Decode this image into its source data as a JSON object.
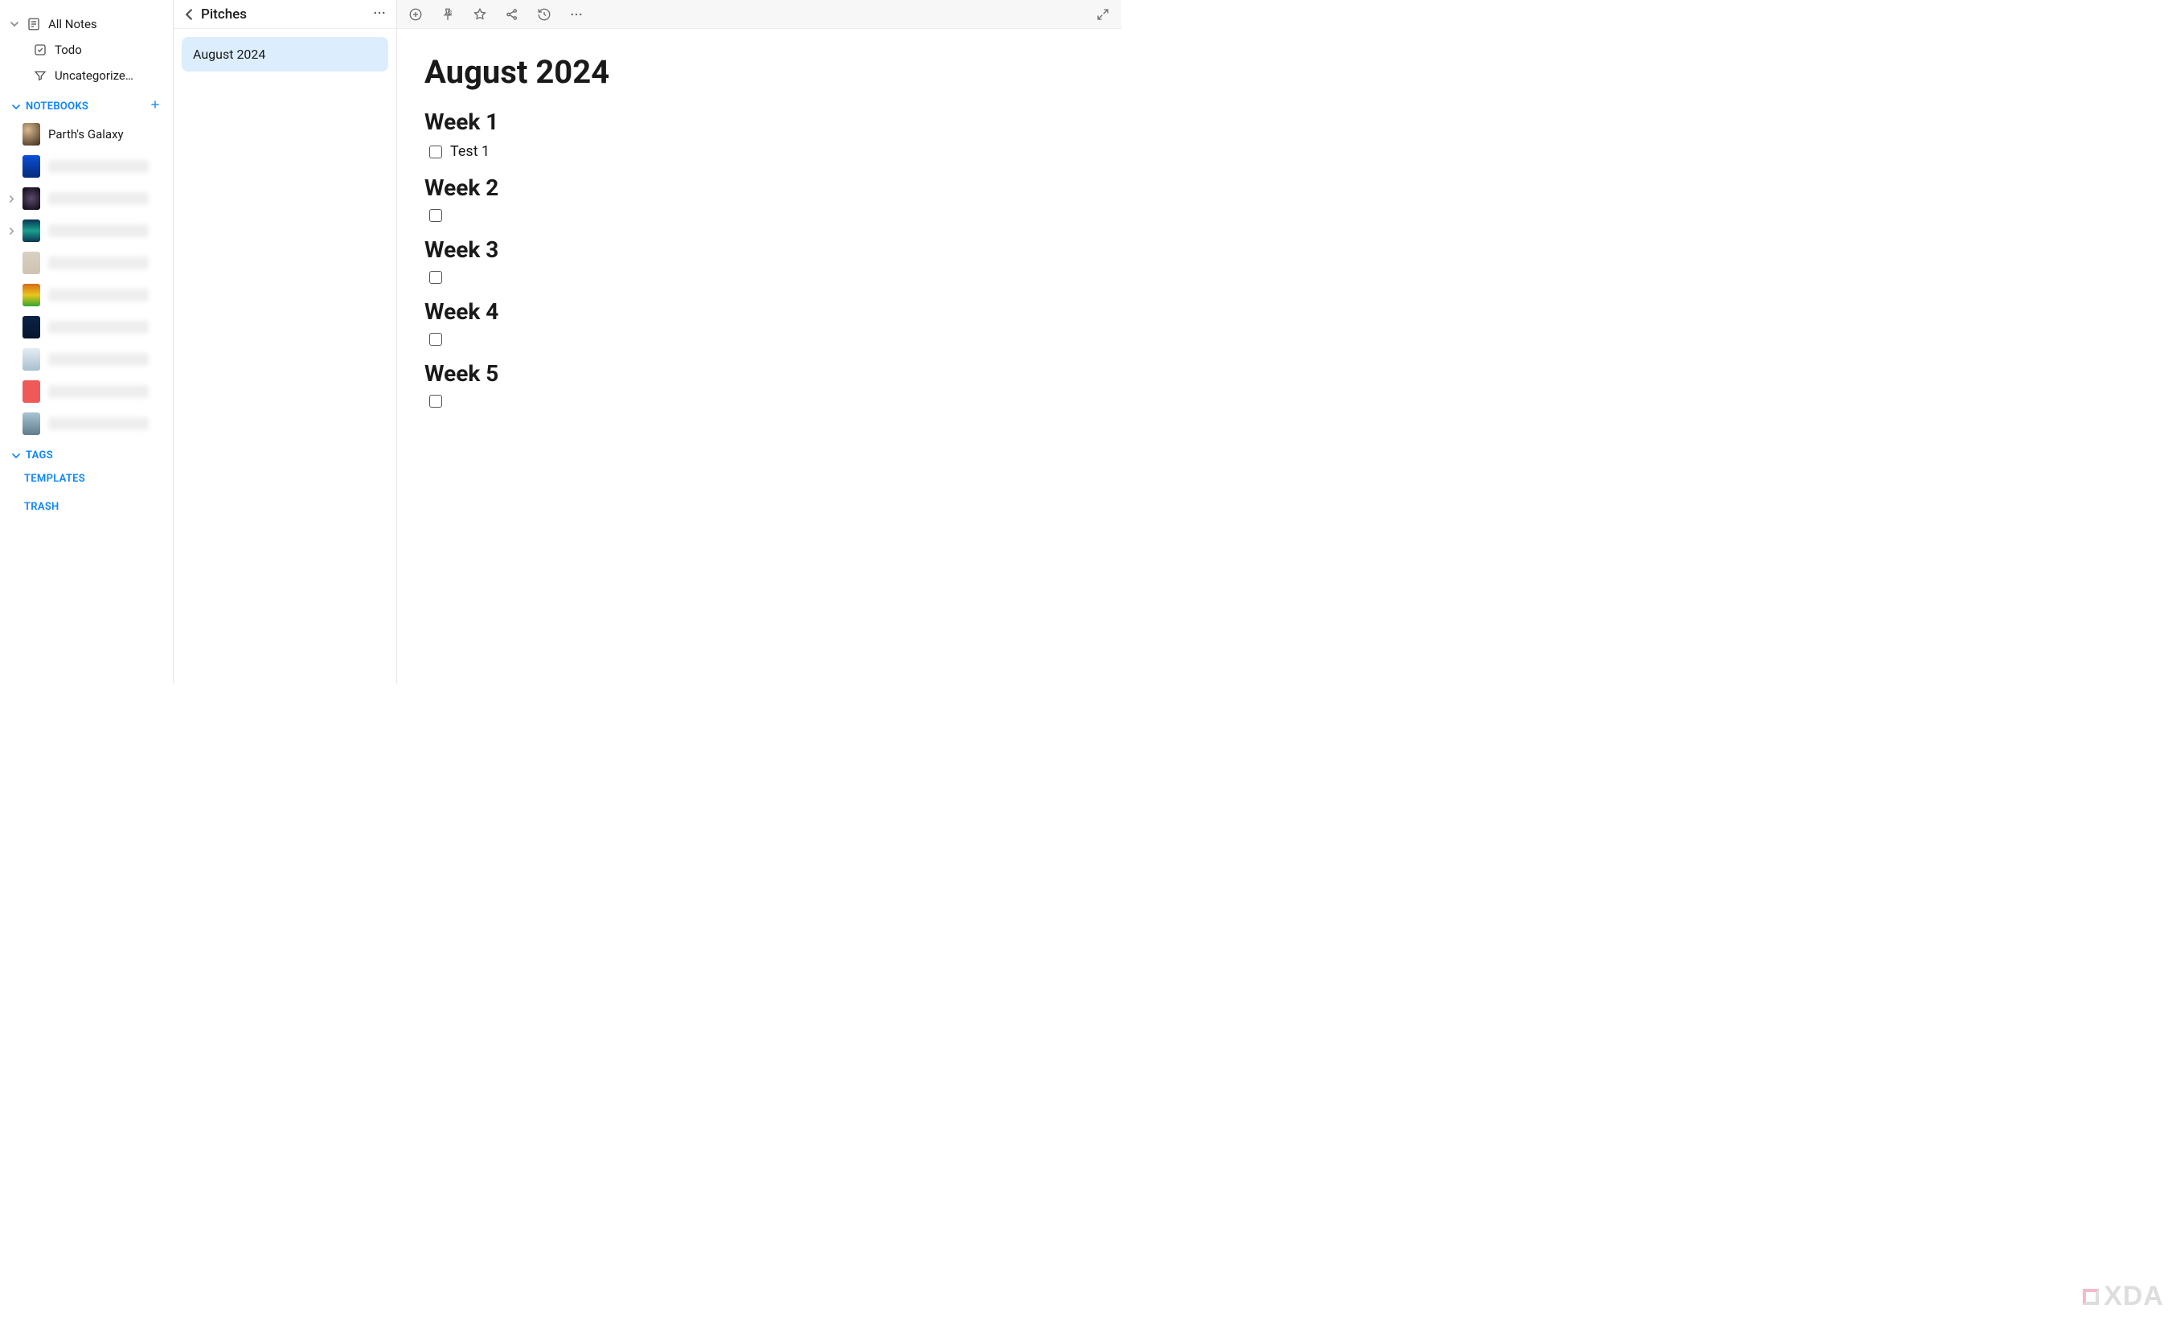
{
  "sidebar": {
    "all_notes_label": "All Notes",
    "todo_label": "Todo",
    "uncategorized_label": "Uncategorize…",
    "sections": {
      "notebooks_label": "NOTEBOOKS",
      "tags_label": "TAGS",
      "templates_label": "TEMPLATES",
      "trash_label": "TRASH"
    },
    "notebooks": [
      {
        "label": "Parth's Galaxy",
        "has_children": false
      },
      {
        "label": "",
        "has_children": false
      },
      {
        "label": "",
        "has_children": true
      },
      {
        "label": "",
        "has_children": true
      },
      {
        "label": "",
        "has_children": false
      },
      {
        "label": "",
        "has_children": false
      },
      {
        "label": "",
        "has_children": false
      },
      {
        "label": "",
        "has_children": false
      },
      {
        "label": "",
        "has_children": false
      },
      {
        "label": "",
        "has_children": false
      }
    ]
  },
  "notelist": {
    "breadcrumb": "Pitches",
    "items": [
      {
        "title": "August 2024",
        "selected": true
      }
    ]
  },
  "editor": {
    "title": "August 2024",
    "weeks": [
      {
        "heading": "Week 1",
        "items": [
          {
            "text": "Test 1",
            "checked": false
          }
        ]
      },
      {
        "heading": "Week 2",
        "items": [
          {
            "text": "",
            "checked": false
          }
        ]
      },
      {
        "heading": "Week 3",
        "items": [
          {
            "text": "",
            "checked": false
          }
        ]
      },
      {
        "heading": "Week 4",
        "items": [
          {
            "text": "",
            "checked": false
          }
        ]
      },
      {
        "heading": "Week 5",
        "items": [
          {
            "text": "",
            "checked": false
          }
        ]
      }
    ]
  },
  "watermark": "XDA"
}
